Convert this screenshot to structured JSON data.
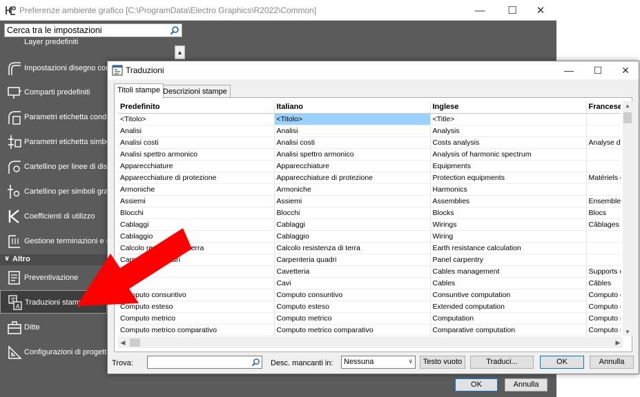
{
  "back_window": {
    "title": "Preferenze ambiente grafico [C:\\ProgramData\\Electro Graphics\\R2022\\Common]",
    "search": {
      "placeholder": "Cerca tra le impostazioni"
    },
    "partial_item": "Layer predefiniti",
    "sidebar_items": [
      {
        "label": "Impostazioni disegno condotti",
        "icon": "conduit-icon"
      },
      {
        "label": "Comparti predefiniti",
        "icon": "compartment-icon"
      },
      {
        "label": "Parametri etichetta condotti",
        "icon": "conduit-label-icon"
      },
      {
        "label": "Parametri etichetta simbolo",
        "icon": "symbol-label-icon"
      },
      {
        "label": "Cartellino per linee di distribuzione",
        "icon": "distribution-line-icon"
      },
      {
        "label": "Cartellino per simboli grafici",
        "icon": "graphic-symbol-icon"
      },
      {
        "label": "Coefficienti di utilizzo",
        "icon": "k-coefficient-icon"
      },
      {
        "label": "Gestione terminazioni e schede",
        "icon": "terminations-icon"
      }
    ],
    "section": "Altro",
    "section_items": [
      {
        "label": "Preventivazione",
        "icon": "estimate-icon"
      },
      {
        "label": "Traduzioni stampe",
        "icon": "translation-icon",
        "selected": true
      },
      {
        "label": "Ditte",
        "icon": "company-icon"
      },
      {
        "label": "Configurazioni di progetto",
        "icon": "project-config-icon"
      }
    ],
    "ok_label": "OK",
    "cancel_label": "Annulla"
  },
  "dialog": {
    "title": "Traduzioni",
    "tabs": [
      "Titoli stampe",
      "Descrizioni stampe"
    ],
    "columns": [
      "Predefinito",
      "Italiano",
      "Inglese",
      "Francese"
    ],
    "rows": [
      [
        "<Titolo>",
        "<Titolo>",
        "<Title>",
        ""
      ],
      [
        "Analisi",
        "Analisi",
        "Analysis",
        ""
      ],
      [
        "Analisi costi",
        "Analisi costi",
        "Costs analysis",
        "Analyse de"
      ],
      [
        "Analisi spettro armonico",
        "Analisi spettro armonico",
        "Analysis of harmonic spectrum",
        ""
      ],
      [
        "Apparecchiature",
        "Apparecchiature",
        "Equipments",
        ""
      ],
      [
        "Apparecchiature di protezione",
        "Apparecchiature di protezione",
        "Protection equipments",
        "Matériels d"
      ],
      [
        "Armoniche",
        "Armoniche",
        "Harmonics",
        ""
      ],
      [
        "Assiemi",
        "Assiemi",
        "Assemblies",
        "Ensemble"
      ],
      [
        "Blocchi",
        "Blocchi",
        "Blocks",
        "Blocs"
      ],
      [
        "Cablaggi",
        "Cablaggi",
        "Wirings",
        "Câblages"
      ],
      [
        "Cablaggio",
        "Cablaggio",
        "Wiring",
        ""
      ],
      [
        "Calcolo resistenza di terra",
        "Calcolo resistenza di terra",
        "Earth resistance calculation",
        ""
      ],
      [
        "Carpenteria quadri",
        "Carpenteria quadri",
        "Panel carpentry",
        ""
      ],
      [
        "Cavetteria",
        "Cavetteria",
        "Cables management",
        "Supports d"
      ],
      [
        "Cavi",
        "Cavi",
        "Cables",
        "Câbles"
      ],
      [
        "Computo consuntivo",
        "Computo consuntivo",
        "Consuntive computation",
        "Computo c"
      ],
      [
        "Computo esteso",
        "Computo esteso",
        "Extended computation",
        "Computo e"
      ],
      [
        "Computo metrico",
        "Computo metrico",
        "Computation",
        "Computo m"
      ],
      [
        "Computo metrico comparativo",
        "Computo metrico comparativo",
        "Comparative computation",
        "Computo m"
      ]
    ],
    "find_label": "Trova:",
    "missing_label": "Desc. mancanti in:",
    "missing_value": "Nessuna",
    "buttons": {
      "empty_text": "Testo vuoto",
      "translate": "Traduci...",
      "ok": "OK",
      "cancel": "Annulla"
    }
  },
  "colors": {
    "back_bg": "#5b5b5b",
    "selection": "#99d1ff",
    "annotation_arrow": "#ff0000",
    "default_button_border": "#0078d7"
  }
}
